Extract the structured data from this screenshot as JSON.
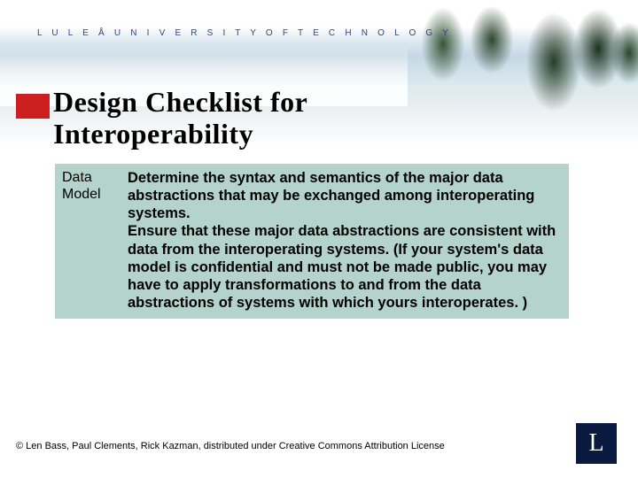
{
  "university": "L U L E Å   U N I V E R S I T Y   O F   T E C H N O L O G Y",
  "title_line1": "Design Checklist for",
  "title_line2": "Interoperability",
  "table": {
    "row_label": "Data Model",
    "para1": "Determine the syntax and semantics of the major data abstractions that may be exchanged among interoperating systems.",
    "para2": "Ensure that these major data abstractions are consistent with data from the interoperating systems.  (If your system's data model is confidential and must not be made public, you may have to apply transformations to and from the data abstractions of systems with which yours interoperates. )"
  },
  "footer": "© Len Bass, Paul Clements, Rick Kazman, distributed under Creative Commons Attribution License",
  "logo_letter": "L"
}
